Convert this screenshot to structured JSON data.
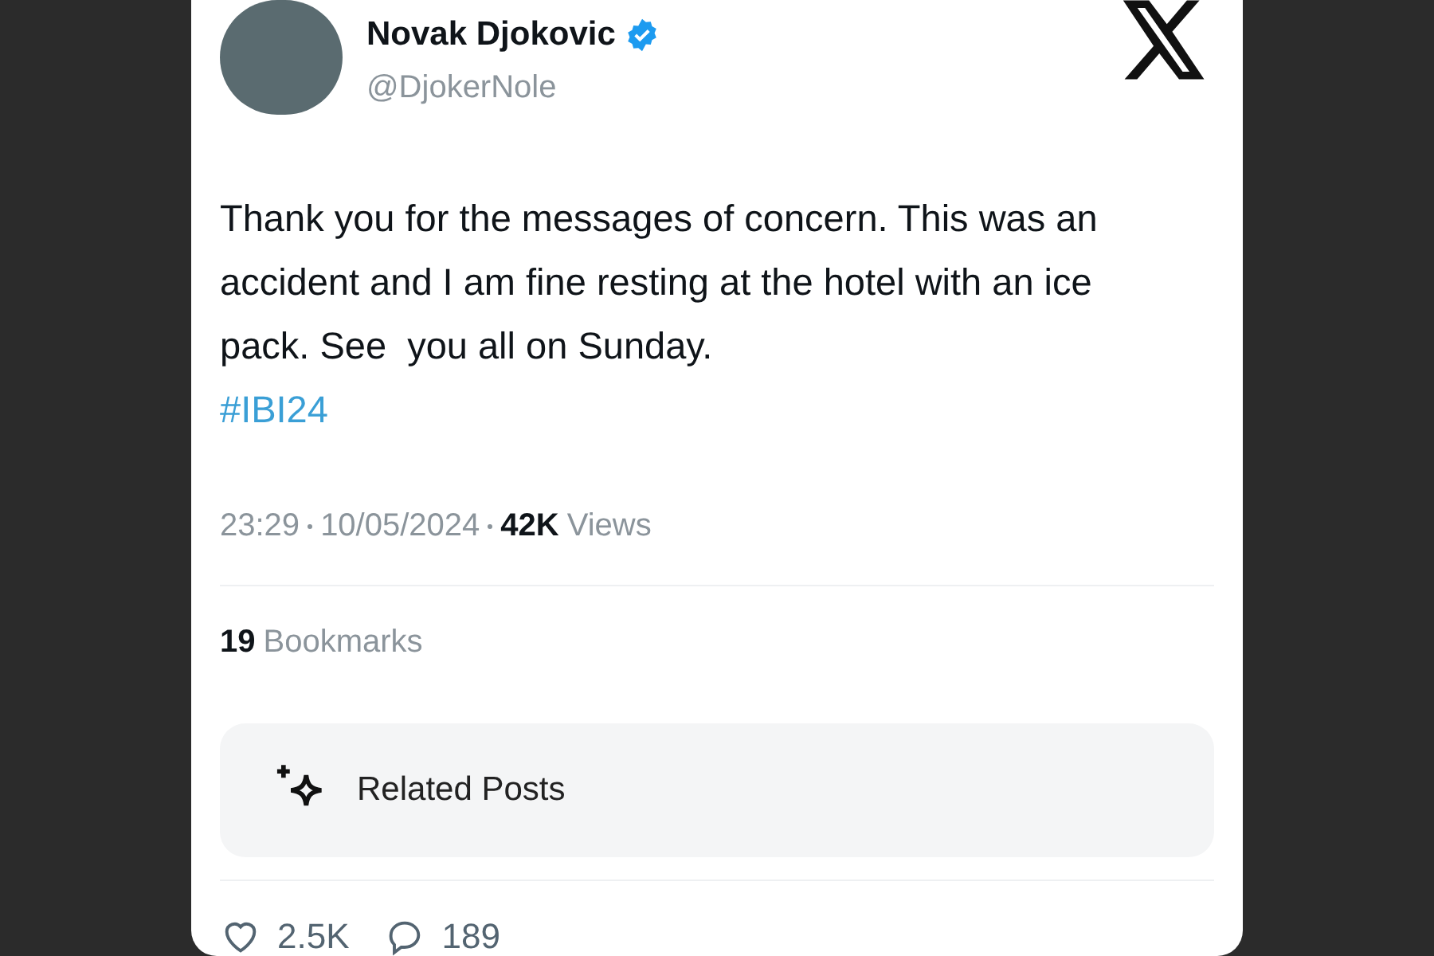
{
  "author": {
    "name": "Novak Djokovic",
    "verified": true,
    "handle": "@DjokerNole"
  },
  "post": {
    "text": "Thank you for the messages of concern. This was an accident and I am fine resting at the hotel with an ice pack. See  you all on Sunday.",
    "hashtag": "#IBI24"
  },
  "meta": {
    "time": "23:29",
    "date": "10/05/2024",
    "views_count": "42K",
    "views_label": "Views"
  },
  "bookmarks": {
    "count": "19",
    "label": "Bookmarks"
  },
  "related": {
    "label": "Related Posts"
  },
  "actions": [
    {
      "kind": "like",
      "count": "2.5K"
    },
    {
      "kind": "reply",
      "count": "189"
    }
  ]
}
